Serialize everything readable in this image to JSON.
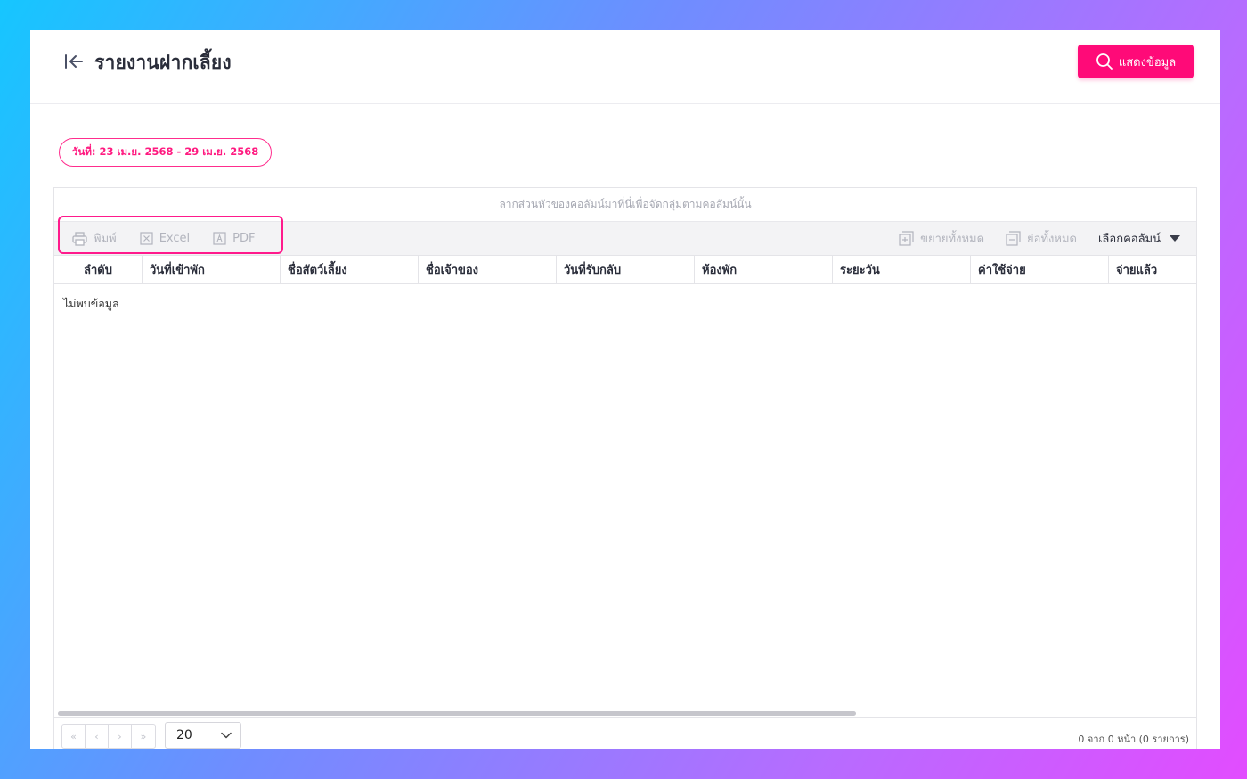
{
  "header": {
    "title": "รายงานฝากเลี้ยง",
    "show_button_label": "แสดงข้อมูล",
    "accent_color": "#ff0a78"
  },
  "filter": {
    "date_range": "วันที่: 23 เม.ย. 2568 - 29 เม.ย. 2568"
  },
  "grid": {
    "group_hint": "ลากส่วนหัวของคอลัมน์มาที่นี่เพื่อจัดกลุ่มตามคอลัมน์นั้น",
    "toolbar": {
      "print_label": "พิมพ์",
      "excel_label": "Excel",
      "pdf_label": "PDF",
      "expand_all_label": "ขยายทั้งหมด",
      "collapse_all_label": "ย่อทั้งหมด",
      "column_chooser_label": "เลือกคอลัมน์"
    },
    "columns": [
      "ลำดับ",
      "วันที่เข้าพัก",
      "ชื่อสัตว์เลี้ยง",
      "ชื่อเจ้าของ",
      "วันที่รับกลับ",
      "ห้องพัก",
      "ระยะวัน",
      "ค่าใช้จ่าย",
      "จ่ายแล้ว"
    ],
    "empty_message": "ไม่พบข้อมูล"
  },
  "pagination": {
    "first": "«",
    "prev": "‹",
    "next": "›",
    "last": "»",
    "page_size": "20",
    "info": "0 จาก 0 หน้า (0 รายการ)"
  }
}
